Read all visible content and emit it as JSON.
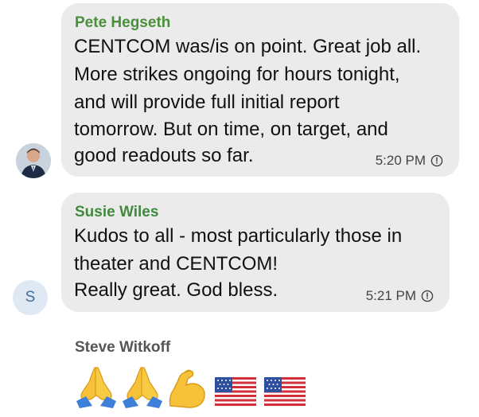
{
  "messages": [
    {
      "sender": "Pete Hegseth",
      "sender_color": "#4a8f3a",
      "avatar": "person-photo-icon",
      "lines": [
        "CENTCOM was/is on point. Great job all.",
        "More strikes ongoing for hours tonight,",
        "and will provide full initial report",
        "tomorrow. But on time, on target, and",
        "good readouts so far."
      ],
      "time": "5:20 PM"
    },
    {
      "sender": "Susie Wiles",
      "sender_color": "#3f8a3d",
      "avatar_letter": "S",
      "lines": [
        "Kudos to all - most particularly those in",
        "theater and CENTCOM!",
        "Really great. God bless."
      ],
      "time": "5:21 PM"
    }
  ],
  "last_message": {
    "sender": "Steve Witkoff",
    "emojis": [
      "folded-hands-icon",
      "folded-hands-icon",
      "flexed-biceps-icon",
      "us-flag-icon",
      "us-flag-icon"
    ]
  }
}
